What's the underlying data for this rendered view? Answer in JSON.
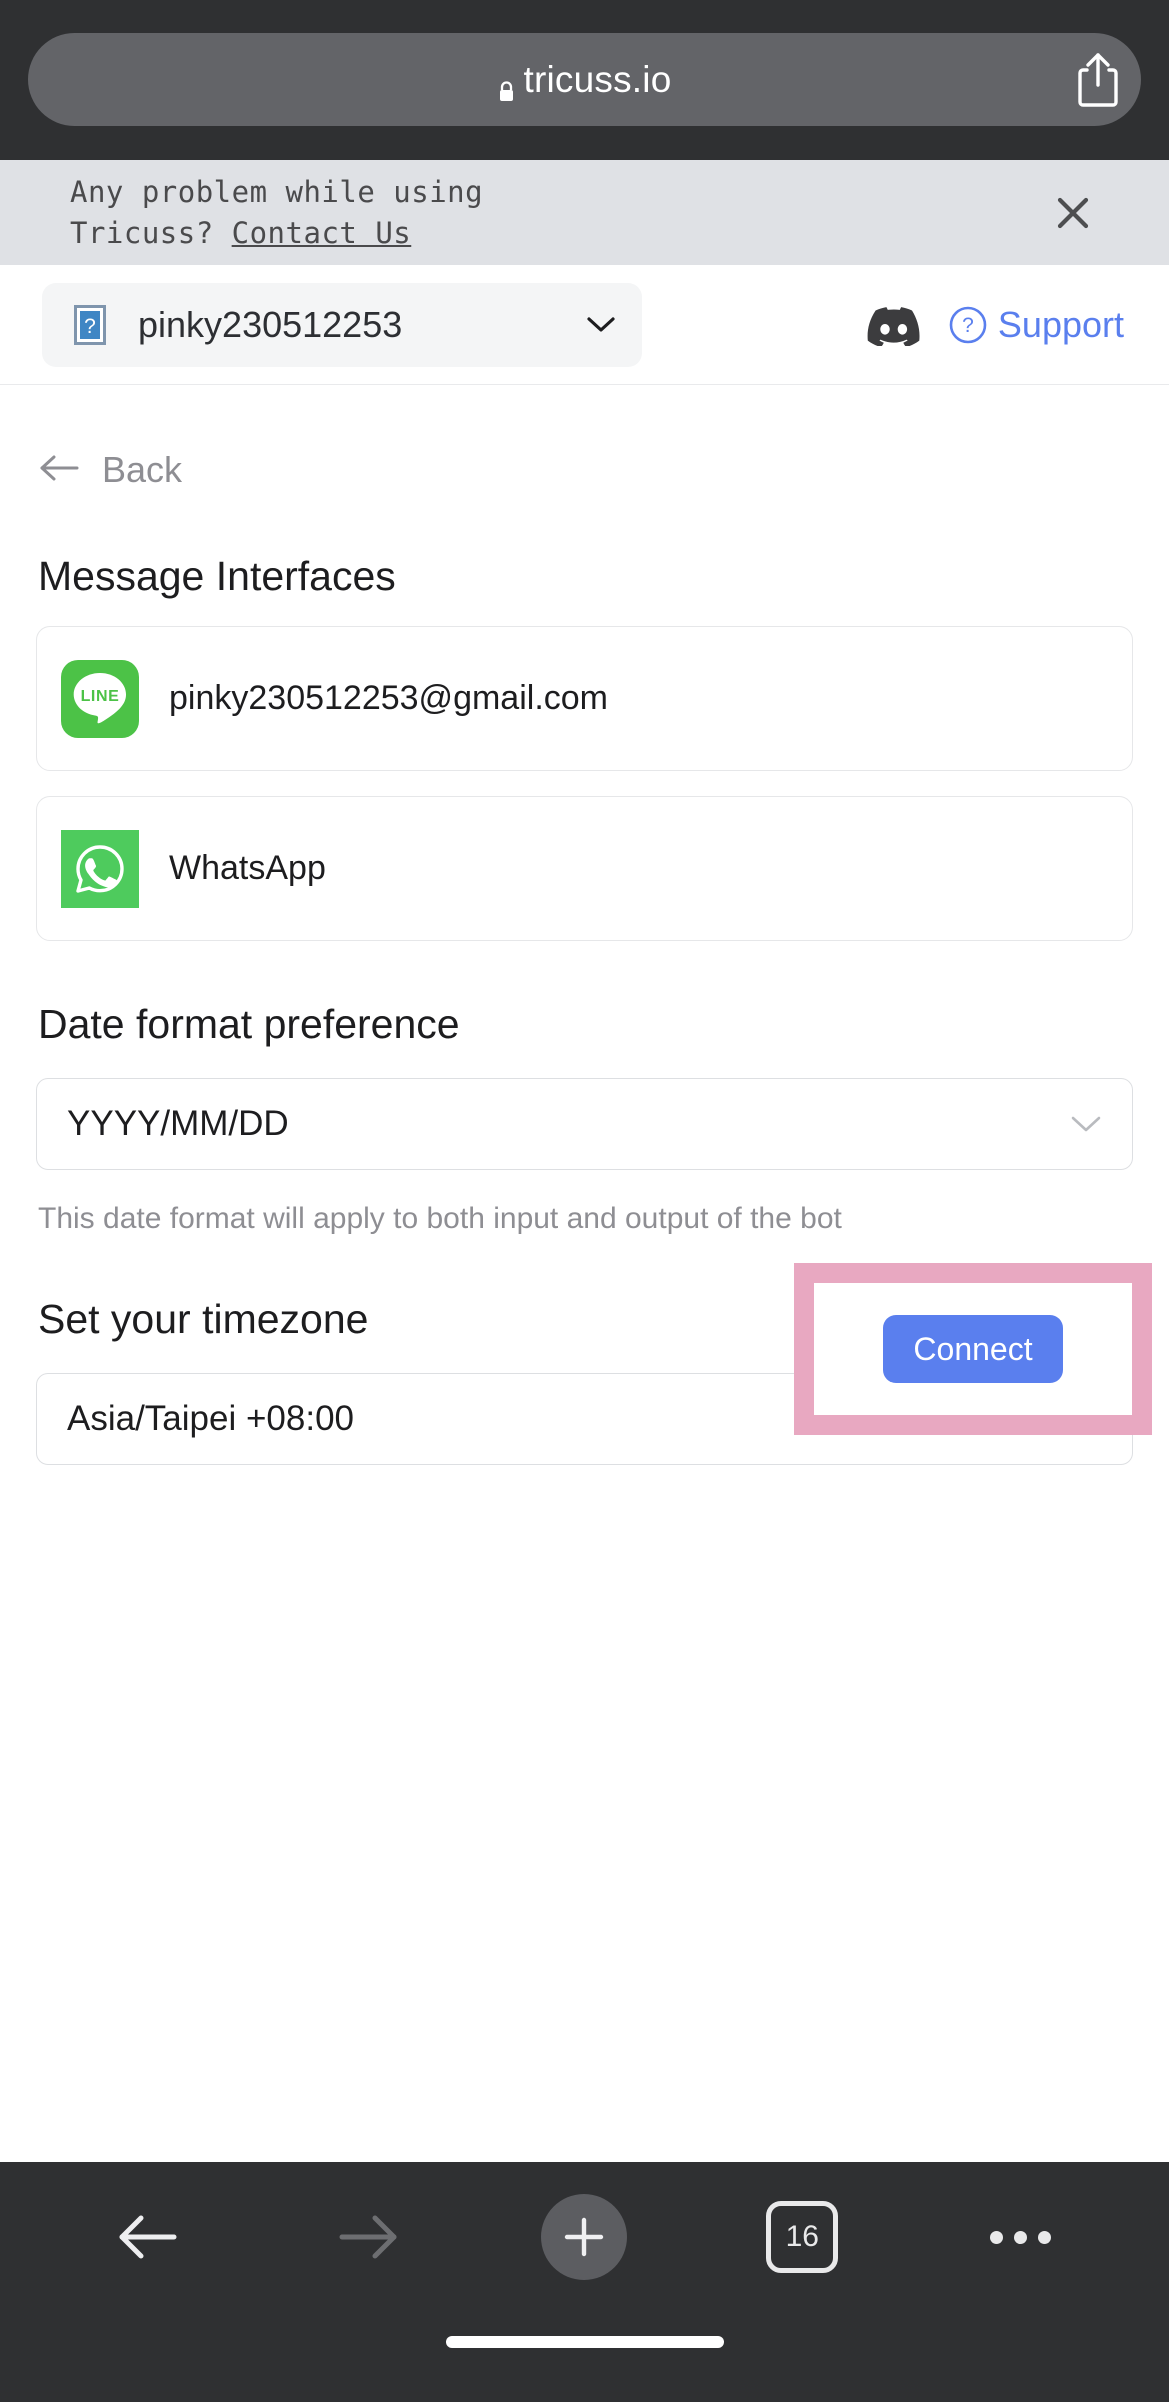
{
  "browser": {
    "url": "tricuss.io",
    "lock_icon": "lock-icon",
    "share_icon": "share-icon",
    "bottom": {
      "back_icon": "arrow-left-icon",
      "forward_icon": "arrow-right-icon",
      "new_tab_icon": "plus-icon",
      "tab_count": "16",
      "more_icon": "ellipsis-icon"
    }
  },
  "banner": {
    "line1": "Any problem while using",
    "line2_prefix": "Tricuss? ",
    "link_label": "Contact Us",
    "close_icon": "close-icon",
    "bg_color": "#dfe1e5"
  },
  "header": {
    "avatar_icon": "broken-image-placeholder-icon",
    "account_name": "pinky230512253",
    "chevron_icon": "chevron-down-icon",
    "discord_icon": "discord-icon",
    "support_icon": "question-circle-icon",
    "support_label": "Support",
    "support_color": "#5a7fee"
  },
  "page": {
    "back_icon": "arrow-left-icon",
    "back_label": "Back",
    "section_title": "Message Interfaces",
    "interfaces": [
      {
        "icon": "line-icon",
        "icon_label": "LINE",
        "label": "pinky230512253@gmail.com",
        "action": null
      },
      {
        "icon": "whatsapp-icon",
        "label": "WhatsApp",
        "action": "Connect"
      }
    ],
    "date_format": {
      "title": "Date format preference",
      "value": "YYYY/MM/DD",
      "chevron_icon": "chevron-down-icon",
      "helper": "This date format will apply to both input and output of the bot"
    },
    "timezone": {
      "title": "Set your timezone",
      "value": "Asia/Taipei +08:00",
      "chevron_icon": "chevron-down-icon"
    },
    "highlight_color": "#e8a8c1",
    "accent_color": "#5a7fee"
  }
}
